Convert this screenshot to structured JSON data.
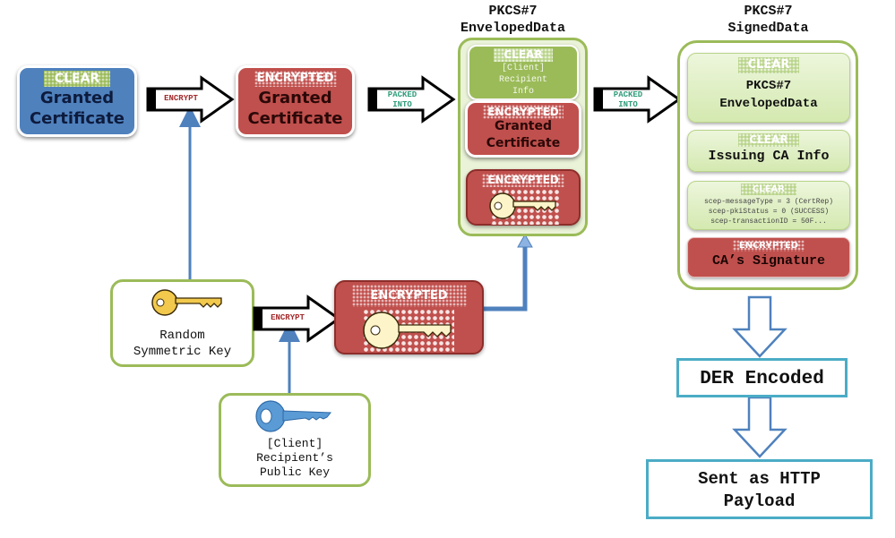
{
  "colors": {
    "clear_blue": "#4f81bd",
    "encrypted_red": "#c0504d",
    "green": "#9bbb59",
    "light_green": "#d7eab5",
    "connector_blue": "#4f81bd",
    "teal": "#4bacc6",
    "key_gold": "#f2c94c",
    "key_cream": "#fdf5c9",
    "key_blue": "#5b9bd5"
  },
  "granted_cert_clear": {
    "tag": "CLEAR",
    "line1": "Granted",
    "line2": "Certificate"
  },
  "arrow_encrypt_1": {
    "label": "ENCRYPT"
  },
  "granted_cert_encrypted": {
    "tag": "ENCRYPTED",
    "line1": "Granted",
    "line2": "Certificate"
  },
  "arrow_packed_1": {
    "line1": "PACKED",
    "line2": "INTO"
  },
  "enveloped_data": {
    "title_line1": "PKCS#7",
    "title_line2": "EnvelopedData",
    "recipient_info": {
      "tag": "CLEAR",
      "line1": "[Client]",
      "line2": "Recipient",
      "line3": "Info"
    },
    "encrypted_cert": {
      "tag": "ENCRYPTED",
      "line1": "Granted",
      "line2": "Certificate"
    },
    "encrypted_key": {
      "tag": "ENCRYPTED",
      "icon": "key-icon"
    }
  },
  "arrow_packed_2": {
    "line1": "PACKED",
    "line2": "INTO"
  },
  "signed_data": {
    "title_line1": "PKCS#7",
    "title_line2": "SignedData",
    "enveloped": {
      "tag": "CLEAR",
      "line1": "PKCS#7",
      "line2": "EnvelopedData"
    },
    "issuing_ca": {
      "tag": "CLEAR",
      "line1": "Issuing CA Info"
    },
    "attributes": {
      "tag": "CLEAR",
      "lines": [
        "scep-messageType = 3 (CertRep)",
        "scep-pkiStatus = 0 (SUCCESS)",
        "scep-transactionID = 50F..."
      ]
    },
    "signature": {
      "tag": "ENCRYPTED",
      "line1": "CA’s Signature"
    }
  },
  "random_key": {
    "icon": "key-icon",
    "line1": "Random",
    "line2": "Symmetric Key"
  },
  "arrow_encrypt_2": {
    "label": "ENCRYPT"
  },
  "encrypted_sym_key": {
    "tag": "ENCRYPTED",
    "icon": "key-icon"
  },
  "public_key": {
    "icon": "key-icon",
    "line1": "[Client]",
    "line2": "Recipient’s",
    "line3": "Public Key"
  },
  "der_encoded": {
    "label": "DER Encoded"
  },
  "http_payload": {
    "line1": "Sent as HTTP",
    "line2": "Payload"
  }
}
